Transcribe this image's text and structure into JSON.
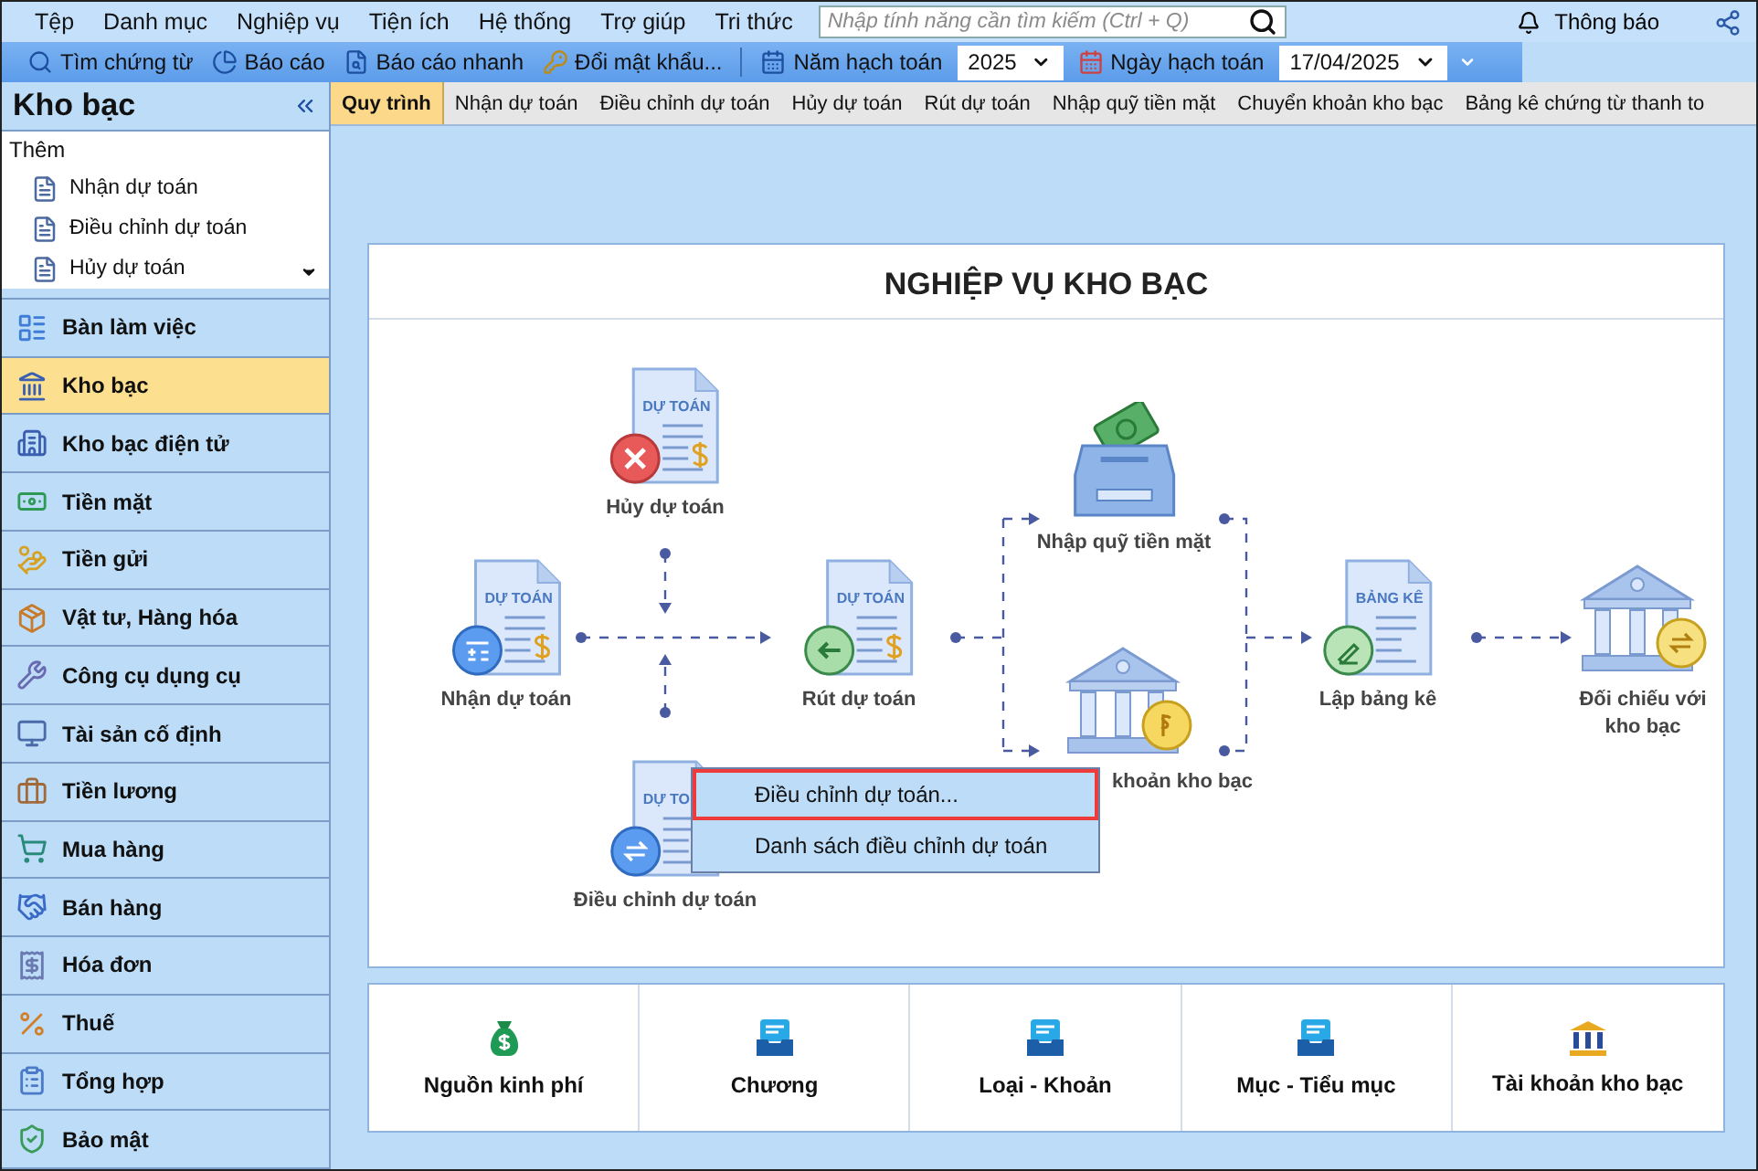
{
  "menubar": {
    "items": [
      "Tệp",
      "Danh mục",
      "Nghiệp vụ",
      "Tiện ích",
      "Hệ thống",
      "Trợ giúp",
      "Tri thức"
    ],
    "search": {
      "placeholder": "Nhập tính năng cần tìm kiếm (Ctrl + Q)"
    },
    "notification": "Thông báo"
  },
  "toolbar": {
    "buttons": [
      "Tìm chứng từ",
      "Báo cáo",
      "Báo cáo nhanh",
      "Đổi mật khẩu..."
    ],
    "year": {
      "label": "Năm hạch toán",
      "value": "2025"
    },
    "date": {
      "label": "Ngày hạch toán",
      "value": "17/04/2025"
    }
  },
  "sidebar": {
    "title": "Kho bạc",
    "more": {
      "title": "Thêm",
      "items": [
        "Nhận dự toán",
        "Điều chỉnh dự toán",
        "Hủy dự toán"
      ]
    },
    "items": [
      {
        "label": "Bàn làm việc",
        "selected": false
      },
      {
        "label": "Kho bạc",
        "selected": true
      },
      {
        "label": "Kho bạc điện tử",
        "selected": false
      },
      {
        "label": "Tiền mặt",
        "selected": false
      },
      {
        "label": "Tiền gửi",
        "selected": false
      },
      {
        "label": "Vật tư, Hàng hóa",
        "selected": false
      },
      {
        "label": "Công cụ dụng cụ",
        "selected": false
      },
      {
        "label": "Tài sản cố định",
        "selected": false
      },
      {
        "label": "Tiền lương",
        "selected": false
      },
      {
        "label": "Mua hàng",
        "selected": false
      },
      {
        "label": "Bán hàng",
        "selected": false
      },
      {
        "label": "Hóa đơn",
        "selected": false
      },
      {
        "label": "Thuế",
        "selected": false
      },
      {
        "label": "Tổng hợp",
        "selected": false
      },
      {
        "label": "Bảo mật",
        "selected": false
      }
    ]
  },
  "tabs": [
    {
      "label": "Quy trình",
      "selected": true
    },
    {
      "label": "Nhận dự toán",
      "selected": false
    },
    {
      "label": "Điều chỉnh dự toán",
      "selected": false
    },
    {
      "label": "Hủy dự toán",
      "selected": false
    },
    {
      "label": "Rút dự toán",
      "selected": false
    },
    {
      "label": "Nhập quỹ tiền mặt",
      "selected": false
    },
    {
      "label": "Chuyển khoản kho bạc",
      "selected": false
    },
    {
      "label": "Bảng kê chứng từ thanh to",
      "selected": false
    }
  ],
  "diagram": {
    "title": "NGHIỆP VỤ KHO BẠC",
    "nodes": [
      {
        "kind": "cancel",
        "doc_label": "DỰ TOÁN",
        "label": "Hủy dự toán"
      },
      {
        "kind": "receive",
        "doc_label": "DỰ TOÁN",
        "label": "Nhận dự toán"
      },
      {
        "kind": "withdraw",
        "doc_label": "DỰ TOÁN",
        "label": "Rút dự toán"
      },
      {
        "kind": "deposit",
        "label": "Nhập quỹ tiền mặt"
      },
      {
        "kind": "transfer",
        "label": "khoản kho bạc"
      },
      {
        "kind": "adjust",
        "doc_label": "DỰ TO",
        "label": "Điều chỉnh dự toán"
      },
      {
        "kind": "statement",
        "doc_label": "BẢNG KÊ",
        "label": "Lập bảng kê"
      },
      {
        "kind": "reconcile",
        "label": "Đối chiếu với kho bạc"
      }
    ],
    "context_menu": [
      {
        "label": "Điều chỉnh dự toán...",
        "selected": true
      },
      {
        "label": "Danh sách điều chỉnh dự toán",
        "selected": false
      }
    ]
  },
  "shortcuts": [
    {
      "kind": "money",
      "label": "Nguồn kinh phí"
    },
    {
      "kind": "tray",
      "label": "Chương"
    },
    {
      "kind": "tray",
      "label": "Loại - Khoản"
    },
    {
      "kind": "tray",
      "label": "Mục - Tiểu mục"
    },
    {
      "kind": "bank",
      "label": "Tài khoản kho bạc"
    }
  ]
}
